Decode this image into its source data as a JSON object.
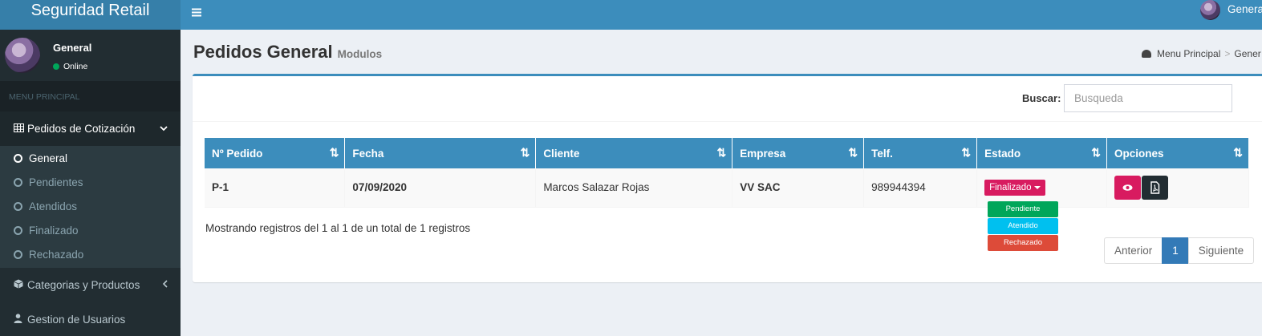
{
  "app": {
    "brand": "Seguridad Retail"
  },
  "topbar": {
    "menu_toggle_icon": "hamburger-icon",
    "user_name": "General"
  },
  "sidebar": {
    "user": {
      "name": "General",
      "status": "Online"
    },
    "section_header": "MENU PRINCIPAL",
    "items": [
      {
        "label": "Pedidos de Cotización",
        "icon": "table-icon",
        "expanded": true,
        "children": [
          "General",
          "Pendientes",
          "Atendidos",
          "Finalizado",
          "Rechazado"
        ]
      },
      {
        "label": "Categorias y Productos",
        "icon": "cube-icon"
      },
      {
        "label": "Gestion de Usuarios",
        "icon": "user-icon"
      }
    ]
  },
  "page": {
    "title": "Pedidos General",
    "subtitle": "Modulos",
    "breadcrumb": [
      "Menu Principal",
      "Gener"
    ]
  },
  "search": {
    "label": "Buscar:",
    "placeholder": "Busqueda",
    "value": ""
  },
  "table": {
    "columns": [
      "Nº Pedido",
      "Fecha",
      "Cliente",
      "Empresa",
      "Telf.",
      "Estado",
      "Opciones"
    ],
    "rows": [
      {
        "pedido": "P-1",
        "fecha": "07/09/2020",
        "cliente": "Marcos Salazar Rojas",
        "empresa": "VV SAC",
        "telf": "989944394",
        "estado": "Finalizado"
      }
    ]
  },
  "status_dropdown": {
    "options": [
      {
        "label": "Pendiente",
        "color": "#00a65a"
      },
      {
        "label": "Atendido",
        "color": "#00c0ef"
      },
      {
        "label": "Rechazado",
        "color": "#dd4b39"
      }
    ]
  },
  "info_text": "Mostrando registros del 1 al 1 de un total de 1 registros",
  "pagination": {
    "prev": "Anterior",
    "current": "1",
    "next": "Siguiente"
  },
  "colors": {
    "primary": "#3c8dbc",
    "sidebar_bg": "#222d32",
    "accent_pink": "#d81b60"
  }
}
